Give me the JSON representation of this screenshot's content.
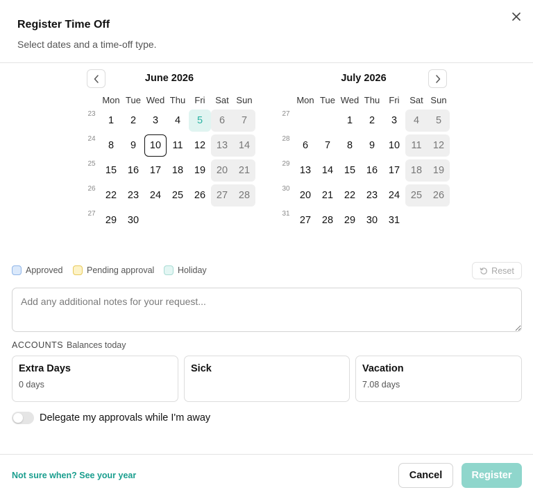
{
  "dialog": {
    "title": "Register Time Off",
    "subtitle": "Select dates and a time-off type."
  },
  "calendar": {
    "weekday_headers": [
      "Mon",
      "Tue",
      "Wed",
      "Thu",
      "Fri",
      "Sat",
      "Sun"
    ],
    "months": [
      {
        "title": "June 2026",
        "weeks": [
          {
            "number": "23",
            "days": [
              "1",
              "2",
              "3",
              "4",
              "5",
              "6",
              "7"
            ]
          },
          {
            "number": "24",
            "days": [
              "8",
              "9",
              "10",
              "11",
              "12",
              "13",
              "14"
            ]
          },
          {
            "number": "25",
            "days": [
              "15",
              "16",
              "17",
              "18",
              "19",
              "20",
              "21"
            ]
          },
          {
            "number": "26",
            "days": [
              "22",
              "23",
              "24",
              "25",
              "26",
              "27",
              "28"
            ]
          },
          {
            "number": "27",
            "days": [
              "29",
              "30",
              "",
              "",
              "",
              "",
              ""
            ]
          }
        ],
        "holidays": [
          "5"
        ],
        "today": "10"
      },
      {
        "title": "July 2026",
        "weeks": [
          {
            "number": "27",
            "days": [
              "",
              "",
              "1",
              "2",
              "3",
              "4",
              "5"
            ]
          },
          {
            "number": "28",
            "days": [
              "6",
              "7",
              "8",
              "9",
              "10",
              "11",
              "12"
            ]
          },
          {
            "number": "29",
            "days": [
              "13",
              "14",
              "15",
              "16",
              "17",
              "18",
              "19"
            ]
          },
          {
            "number": "30",
            "days": [
              "20",
              "21",
              "22",
              "23",
              "24",
              "25",
              "26"
            ]
          },
          {
            "number": "31",
            "days": [
              "27",
              "28",
              "29",
              "30",
              "31",
              "",
              ""
            ]
          }
        ],
        "holidays": [],
        "today": ""
      }
    ],
    "prev_icon": "chevron-left-icon",
    "next_icon": "chevron-right-icon"
  },
  "legend": {
    "approved": "Approved",
    "pending": "Pending approval",
    "holiday": "Holiday",
    "reset_label": "Reset"
  },
  "notes": {
    "placeholder": "Add any additional notes for your request...",
    "value": ""
  },
  "accounts": {
    "heading": "ACCOUNTS",
    "subheading": "Balances today",
    "items": [
      {
        "name": "Extra Days",
        "balance": "0 days"
      },
      {
        "name": "Sick",
        "balance": ""
      },
      {
        "name": "Vacation",
        "balance": "7.08 days"
      }
    ]
  },
  "delegate": {
    "label": "Delegate my approvals while I'm away",
    "enabled": false
  },
  "footer": {
    "link_text": "Not sure when? See your year",
    "cancel_label": "Cancel",
    "register_label": "Register"
  },
  "colors": {
    "accent": "#2bb3a3",
    "register_disabled": "#8fd6cc",
    "holiday_bg": "#e0f4f1",
    "weekend_bg": "#efefef"
  }
}
